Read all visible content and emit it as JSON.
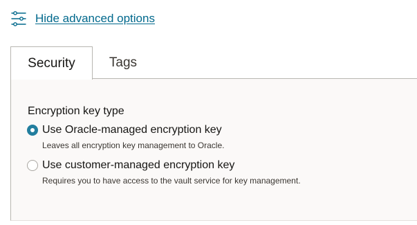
{
  "advanced_toggle": {
    "label": "Hide advanced options",
    "icon": "sliders-icon"
  },
  "tabs": [
    {
      "label": "Security",
      "selected": true
    },
    {
      "label": "Tags",
      "selected": false
    }
  ],
  "security": {
    "field_label": "Encryption key type",
    "options": [
      {
        "label": "Use Oracle-managed encryption key",
        "description": "Leaves all encryption key management to Oracle.",
        "selected": true
      },
      {
        "label": "Use customer-managed encryption key",
        "description": "Requires you to have access to the vault service for key management.",
        "selected": false
      }
    ]
  },
  "colors": {
    "link": "#00688c",
    "radio_selected": "#227e9e",
    "panel_background": "#fbf9f8",
    "border": "#b8b6b1"
  }
}
